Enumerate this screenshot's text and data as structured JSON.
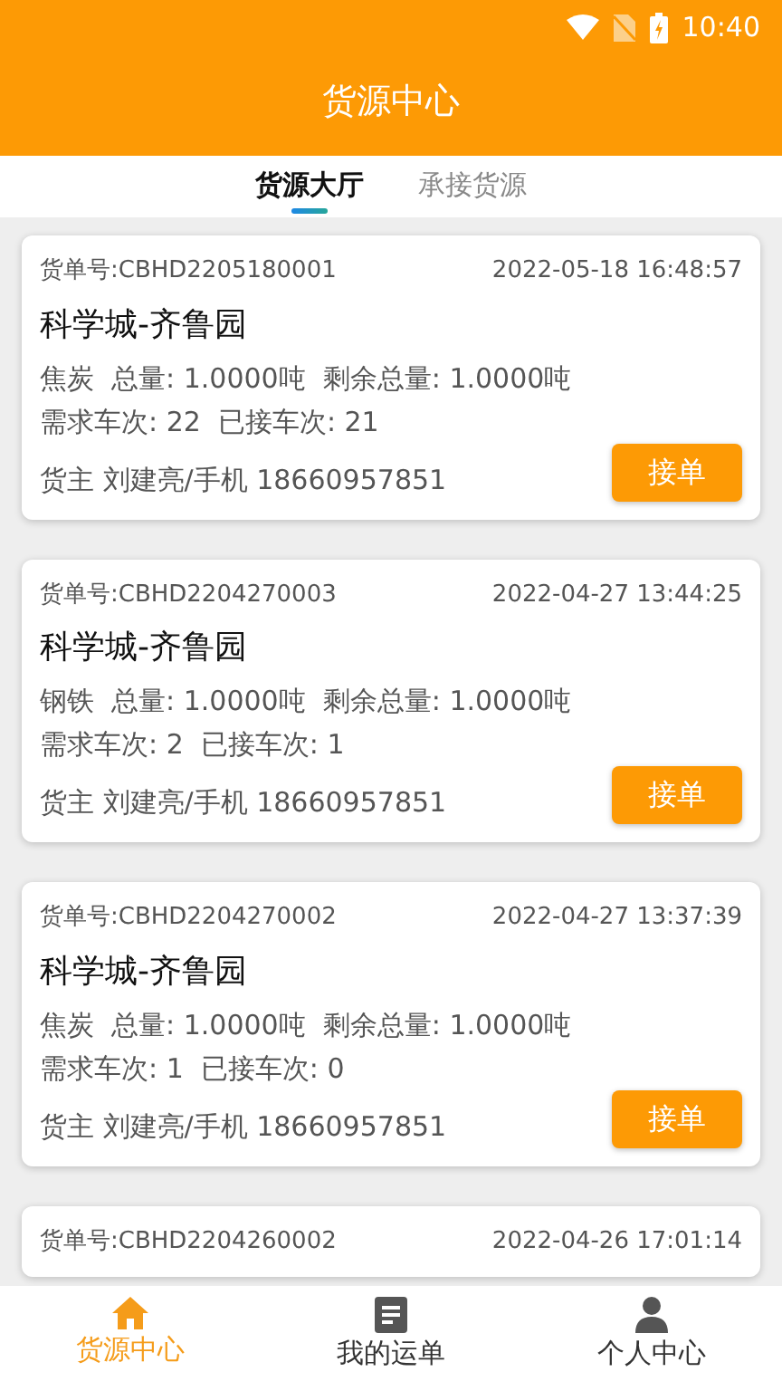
{
  "status_bar": {
    "time": "10:40"
  },
  "header": {
    "title": "货源中心"
  },
  "tabs": [
    {
      "label": "货源大厅",
      "selected": true
    },
    {
      "label": "承接货源",
      "selected": false
    }
  ],
  "orders": [
    {
      "order_no": "货单号:CBHD2205180001",
      "time": "2022-05-18 16:48:57",
      "route": "科学城-齐鲁园",
      "cargo": "焦炭  总量: 1.0000吨  剩余总量: 1.0000吨",
      "trips": "需求车次: 22  已接车次: 21",
      "owner": "货主 刘建亮/手机 18660957851",
      "button": "接单"
    },
    {
      "order_no": "货单号:CBHD2204270003",
      "time": "2022-04-27 13:44:25",
      "route": "科学城-齐鲁园",
      "cargo": "钢铁  总量: 1.0000吨  剩余总量: 1.0000吨",
      "trips": "需求车次: 2  已接车次: 1",
      "owner": "货主 刘建亮/手机 18660957851",
      "button": "接单"
    },
    {
      "order_no": "货单号:CBHD2204270002",
      "time": "2022-04-27 13:37:39",
      "route": "科学城-齐鲁园",
      "cargo": "焦炭  总量: 1.0000吨  剩余总量: 1.0000吨",
      "trips": "需求车次: 1  已接车次: 0",
      "owner": "货主 刘建亮/手机 18660957851",
      "button": "接单"
    },
    {
      "order_no": "货单号:CBHD2204260002",
      "time": "2022-04-26 17:01:14"
    }
  ],
  "bottom_nav": [
    {
      "label": "货源中心",
      "selected": true
    },
    {
      "label": "我的运单",
      "selected": false
    },
    {
      "label": "个人中心",
      "selected": false
    }
  ]
}
